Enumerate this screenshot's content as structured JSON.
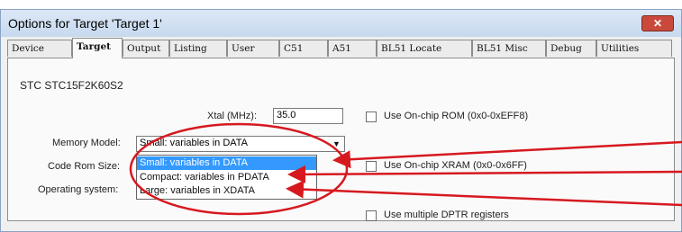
{
  "window": {
    "title": "Options for Target 'Target 1'",
    "close_glyph": "✕"
  },
  "tabs": [
    {
      "label": "Device",
      "active": false
    },
    {
      "label": "Target",
      "active": true
    },
    {
      "label": "Output",
      "active": false
    },
    {
      "label": "Listing",
      "active": false
    },
    {
      "label": "User",
      "active": false
    },
    {
      "label": "C51",
      "active": false
    },
    {
      "label": "A51",
      "active": false
    },
    {
      "label": "BL51 Locate",
      "active": false
    },
    {
      "label": "BL51 Misc",
      "active": false
    },
    {
      "label": "Debug",
      "active": false
    },
    {
      "label": "Utilities",
      "active": false
    }
  ],
  "device_name": "STC STC15F2K60S2",
  "xtal": {
    "label": "Xtal (MHz):",
    "value": "35.0"
  },
  "memory_model": {
    "label": "Memory Model:",
    "value": "Small: variables in DATA"
  },
  "code_rom_size": {
    "label": "Code Rom Size:"
  },
  "operating_system": {
    "label": "Operating system:"
  },
  "dropdown_options": [
    {
      "label": "Small: variables in DATA",
      "selected": true
    },
    {
      "label": "Compact: variables in PDATA",
      "selected": false
    },
    {
      "label": "Large: variables in XDATA",
      "selected": false
    }
  ],
  "checkboxes": {
    "onchip_rom": "Use On-chip ROM (0x0-0xEFF8)",
    "onchip_xram": "Use On-chip XRAM (0x0-0x6FF)",
    "multiple_dptr": "Use multiple DPTR registers"
  },
  "annotation_color": "#d6191f"
}
